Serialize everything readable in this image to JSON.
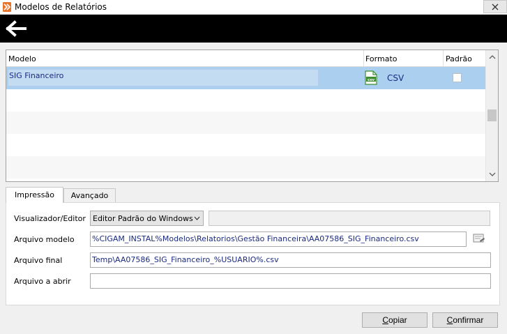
{
  "window": {
    "title": "Modelos de Relatórios",
    "icon": "cigam-app-icon",
    "close": "close-icon"
  },
  "toolbar": {
    "back_icon": "back-arrow-icon"
  },
  "grid": {
    "headers": {
      "model": "Modelo",
      "format": "Formato",
      "default": "Padrão"
    },
    "rows": [
      {
        "model": "SIG Financeiro",
        "format_icon": "csv-file-icon",
        "format": "CSV",
        "default": false
      }
    ]
  },
  "tabs": [
    {
      "label": "Impressão",
      "active": true
    },
    {
      "label": "Avançado",
      "active": false
    }
  ],
  "form": {
    "viewer_label": "Visualizador/Editor",
    "viewer_value": "Editor Padrão do Windows",
    "model_file_label": "Arquivo modelo",
    "model_file_value": "%CIGAM_INSTAL%Modelos\\Relatorios\\Gestão Financeira\\AA07586_SIG_Financeiro.csv",
    "final_file_label": "Arquivo final",
    "final_file_value": "Temp\\AA07586_SIG_Financeiro_%USUARIO%.csv",
    "open_file_label": "Arquivo a abrir",
    "open_file_value": ""
  },
  "buttons": {
    "copy": {
      "hotkey": "C",
      "rest": "opiar"
    },
    "confirm": {
      "hotkey": "C",
      "rest": "onfirmar"
    }
  },
  "colors": {
    "selected_row": "#abd0ef",
    "toolbar": "#000000",
    "text_blue": "#1a2a80"
  }
}
